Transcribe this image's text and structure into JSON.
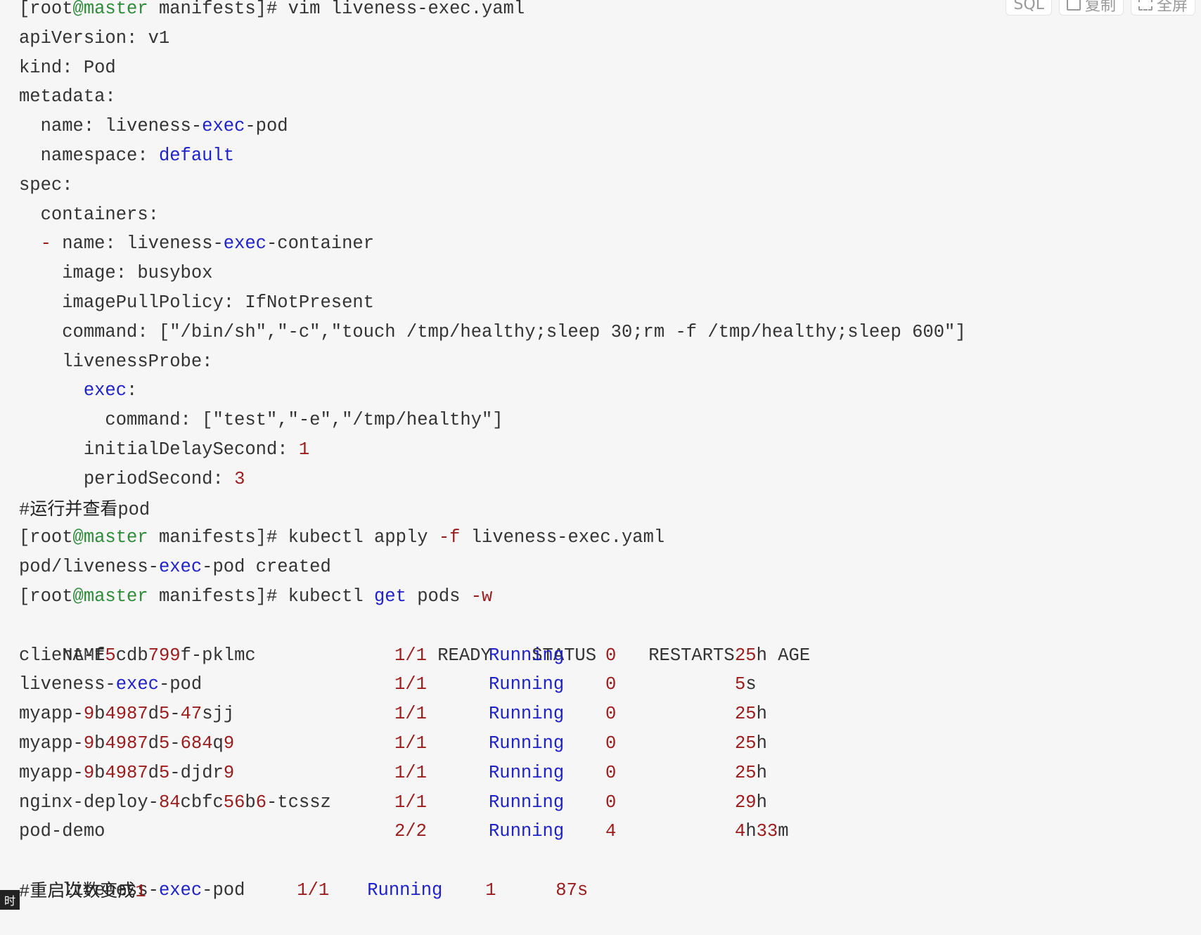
{
  "toolbar": {
    "lang": "SQL",
    "copy": "复制",
    "fullscreen": "全屏"
  },
  "code": {
    "l1": {
      "prompt_open": "[root",
      "at_host": "@master",
      "prompt_rest": " manifests]# vim liveness-exec.yaml"
    },
    "l2": "apiVersion: v1",
    "l3": "kind: Pod",
    "l4": "metadata:",
    "l5": {
      "a": "  name: liveness-",
      "b": "exec",
      "c": "-pod"
    },
    "l6": {
      "a": "  namespace: ",
      "b": "default"
    },
    "l7": "spec:",
    "l8": "  containers:",
    "l9": {
      "dash": "  -",
      "a": " name: liveness-",
      "b": "exec",
      "c": "-container"
    },
    "l10": "    image: busybox",
    "l11": "    imagePullPolicy: IfNotPresent",
    "l12": "    command: [\"/bin/sh\",\"-c\",\"touch /tmp/healthy;sleep 30;rm -f /tmp/healthy;sleep 600\"]",
    "l13": "    livenessProbe:",
    "l14": {
      "a": "      ",
      "b": "exec",
      "c": ":"
    },
    "l15": "        command: [\"test\",\"-e\",\"/tmp/healthy\"]",
    "l16": {
      "a": "      initialDelaySecond: ",
      "b": "1"
    },
    "l17": {
      "a": "      periodSecond: ",
      "b": "3"
    },
    "l18": {
      "hash": "#",
      "cn": "运行并查看",
      "tail": "pod"
    },
    "l19": {
      "prompt_open": "[root",
      "at_host": "@master",
      "prompt_rest": " manifests]# kubectl apply ",
      "flag": "-f",
      "rest": " liveness-exec.yaml"
    },
    "l20": {
      "a": "pod/liveness-",
      "b": "exec",
      "c": "-pod created"
    },
    "l21": {
      "prompt_open": "[root",
      "at_host": "@master",
      "prompt_rest": " manifests]# kubectl ",
      "get": "get",
      "rest": " pods ",
      "flag": "-w"
    },
    "table": {
      "headers": [
        "NAME",
        "READY",
        "STATUS",
        "RESTARTS",
        "AGE"
      ],
      "rows": [
        {
          "name": "client-f5cdb799f-pklmc",
          "ready": "1/1",
          "status": "Running",
          "restarts": "0",
          "age": "25h"
        },
        {
          "name": "liveness-exec-pod",
          "ready": "1/1",
          "status": "Running",
          "restarts": "0",
          "age": "5s"
        },
        {
          "name": "myapp-9b4987d5-47sjj",
          "ready": "1/1",
          "status": "Running",
          "restarts": "0",
          "age": "25h"
        },
        {
          "name": "myapp-9b4987d5-684q9",
          "ready": "1/1",
          "status": "Running",
          "restarts": "0",
          "age": "25h"
        },
        {
          "name": "myapp-9b4987d5-djdr9",
          "ready": "1/1",
          "status": "Running",
          "restarts": "0",
          "age": "25h"
        },
        {
          "name": "nginx-deploy-84cbfc56b6-tcssz",
          "ready": "1/1",
          "status": "Running",
          "restarts": "0",
          "age": "29h"
        },
        {
          "name": "pod-demo",
          "ready": "2/2",
          "status": "Running",
          "restarts": "4",
          "age": "4h33m"
        }
      ]
    },
    "watch_line": {
      "name": "liveness-exec-pod",
      "ready": "1/1",
      "status": "Running",
      "restarts": "1",
      "age": "87s"
    },
    "l_last": {
      "hash": "#",
      "cn": "重启次数变成",
      "num": "1"
    }
  },
  "corner_label": "时"
}
